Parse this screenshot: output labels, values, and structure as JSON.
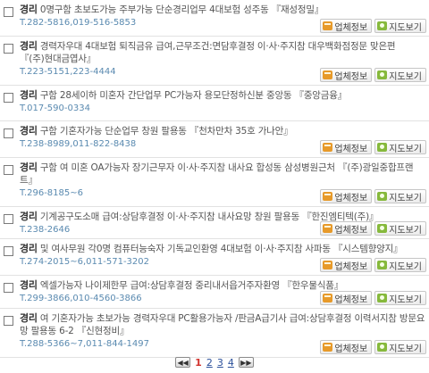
{
  "buttons": {
    "company_info": "업체정보",
    "map_view": "지도보기"
  },
  "listings": [
    {
      "category": "경리",
      "text": "0명구함 초보도가능 주부가능 단순경리업무 4대보험 성주동 『재성정밀』",
      "phone": "T.282-5816,019-516-5853"
    },
    {
      "category": "경리",
      "text": "경력자우대 4대보험 퇴직금유 급여,근무조건:면담후결정 이·사·주지참 대우백화점정문 맞은편 『(주)현대금엽사』",
      "phone": "T.223-5151,223-4444"
    },
    {
      "category": "경리",
      "text": "구함 28세이하 미혼자 간단업무 PC가능자 용모단정하신분 중앙동 『중앙금융』",
      "phone": "T.017-590-0334"
    },
    {
      "category": "경리",
      "text": "구함 기혼자가능 단순업무 창원 팔용동 『천차만차 35호 가나안』",
      "phone": "T.238-8989,011-822-8438"
    },
    {
      "category": "경리",
      "text": "구함 여 미혼 OA가능자 장기근무자 이·사·주지참 내사요 합성동 삼성병원근처 『(주)광일중합프랜트』",
      "phone": "T.296-8185~6"
    },
    {
      "category": "경리",
      "text": "기계공구도소매 급여:상담후결정 이·사·주지참 내사요망 창원 팔용동 『한진엠티텍(주)』",
      "phone": "T.238-2646"
    },
    {
      "category": "경리",
      "text": "및 여사무원 각0명 컴퓨터능숙자 기독교인환영 4대보험 이·사·주지참 사파동 『시스템향양지』",
      "phone": "T.274-2015~6,011-571-3202"
    },
    {
      "category": "경리",
      "text": "엑셀가능자 나이제한무 급여:상담후결정 중리내서읍거주자환영 『한우물식품』",
      "phone": "T.299-3866,010-4560-3866"
    },
    {
      "category": "경리",
      "text": "여 기혼자가능 초보가능 경력자우대 PC활용가능자 /판금A급기사 급여:상담후결정 이력서지참 방문요망 팔용동 6-2 『신현정비』",
      "phone": "T.288-5366~7,011-844-1497"
    }
  ],
  "pagination": {
    "prev_label": "◀◀",
    "next_label": "▶▶",
    "pages": [
      "1",
      "2",
      "3",
      "4"
    ],
    "current": "1"
  }
}
